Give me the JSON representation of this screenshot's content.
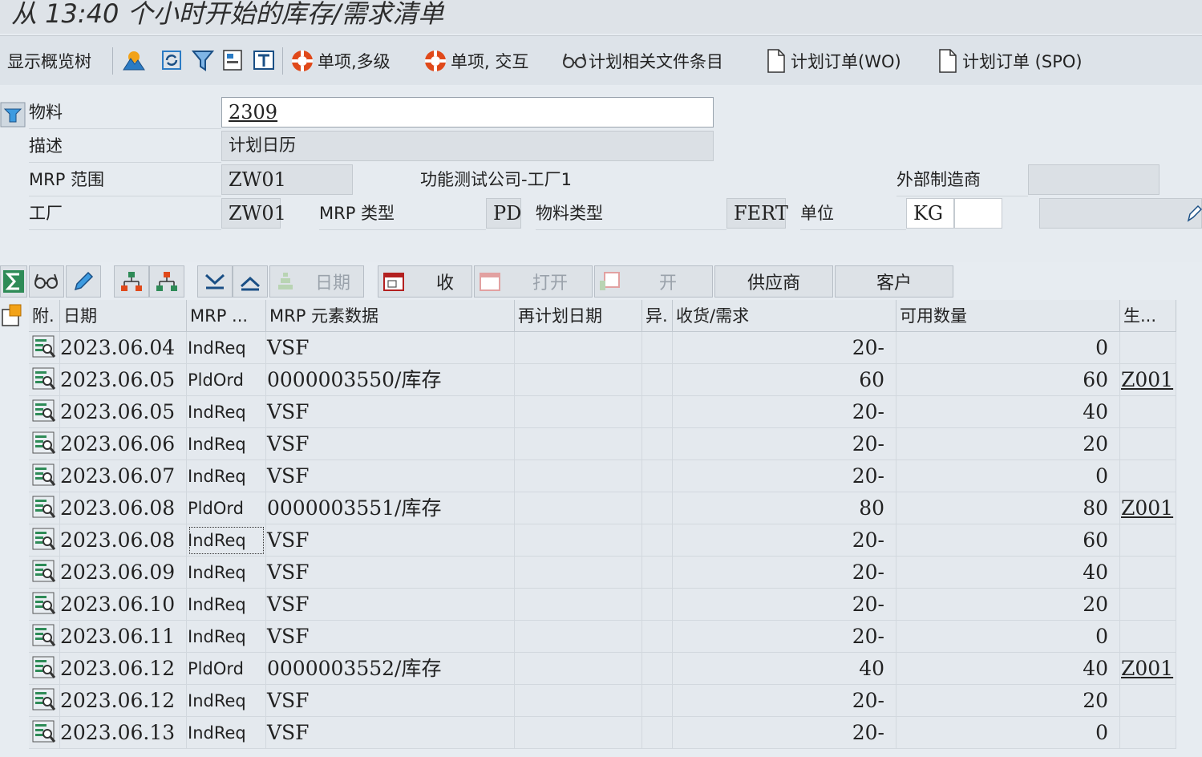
{
  "window": {
    "title": "从 13:40 个小时开始的库存/需求清单"
  },
  "toolbar": {
    "show_tree": "显示概览树",
    "single_multi": "单项,多级",
    "single_interactive": "单项, 交互",
    "planning_file": "计划相关文件条目",
    "planned_order_wo": "计划订单(WO)",
    "planned_order_spo": "计划订单 (SPO)"
  },
  "header": {
    "material_label": "物料",
    "material_value": "2309",
    "desc_label": "描述",
    "desc_value": "计划日历",
    "mrp_area_label": "MRP 范围",
    "mrp_area_value": "ZW01",
    "mrp_area_text": "功能测试公司-工厂1",
    "ext_mfr_label": "外部制造商",
    "ext_mfr_value": "",
    "plant_label": "工厂",
    "plant_value": "ZW01",
    "mrp_type_label": "MRP 类型",
    "mrp_type_value": "PD",
    "mat_type_label": "物料类型",
    "mat_type_value": "FERT",
    "unit_label": "单位",
    "unit_value": "KG"
  },
  "actions": {
    "date": "日期",
    "receipt": "收",
    "open1": "打开",
    "open2": "开",
    "supplier": "供应商",
    "customer": "客户"
  },
  "columns": {
    "att": "附.",
    "date": "日期",
    "mrp": "MRP ...",
    "element": "MRP 元素数据",
    "resched": "再计划日期",
    "exc": "异.",
    "rec_req": "收货/需求",
    "avail": "可用数量",
    "prod": "生..."
  },
  "rows": [
    {
      "date": "2023.06.04",
      "mrp": "IndReq",
      "element": "VSF",
      "rr": "20-",
      "avail": "0",
      "prod": ""
    },
    {
      "date": "2023.06.05",
      "mrp": "PldOrd",
      "element": "0000003550/库存",
      "rr": "60",
      "avail": "60",
      "prod": "Z001"
    },
    {
      "date": "2023.06.05",
      "mrp": "IndReq",
      "element": "VSF",
      "rr": "20-",
      "avail": "40",
      "prod": ""
    },
    {
      "date": "2023.06.06",
      "mrp": "IndReq",
      "element": "VSF",
      "rr": "20-",
      "avail": "20",
      "prod": ""
    },
    {
      "date": "2023.06.07",
      "mrp": "IndReq",
      "element": "VSF",
      "rr": "20-",
      "avail": "0",
      "prod": ""
    },
    {
      "date": "2023.06.08",
      "mrp": "PldOrd",
      "element": "0000003551/库存",
      "rr": "80",
      "avail": "80",
      "prod": "Z001"
    },
    {
      "date": "2023.06.08",
      "mrp": "IndReq",
      "element": "VSF",
      "rr": "20-",
      "avail": "60",
      "prod": ""
    },
    {
      "date": "2023.06.09",
      "mrp": "IndReq",
      "element": "VSF",
      "rr": "20-",
      "avail": "40",
      "prod": ""
    },
    {
      "date": "2023.06.10",
      "mrp": "IndReq",
      "element": "VSF",
      "rr": "20-",
      "avail": "20",
      "prod": ""
    },
    {
      "date": "2023.06.11",
      "mrp": "IndReq",
      "element": "VSF",
      "rr": "20-",
      "avail": "0",
      "prod": ""
    },
    {
      "date": "2023.06.12",
      "mrp": "PldOrd",
      "element": "0000003552/库存",
      "rr": "40",
      "avail": "40",
      "prod": "Z001"
    },
    {
      "date": "2023.06.12",
      "mrp": "IndReq",
      "element": "VSF",
      "rr": "20-",
      "avail": "20",
      "prod": ""
    },
    {
      "date": "2023.06.13",
      "mrp": "IndReq",
      "element": "VSF",
      "rr": "20-",
      "avail": "0",
      "prod": ""
    }
  ],
  "colors": {
    "accent": "#1f6fbf",
    "orange": "#e0491a",
    "green": "#2e8b57"
  }
}
